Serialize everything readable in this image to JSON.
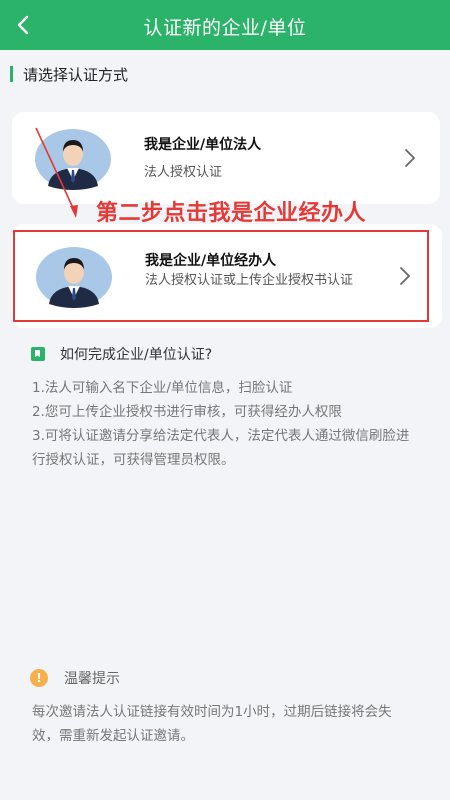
{
  "header": {
    "title": "认证新的企业/单位"
  },
  "section": {
    "title": "请选择认证方式"
  },
  "options": [
    {
      "title": "我是企业/单位法人",
      "subtitle": "法人授权认证"
    },
    {
      "title": "我是企业/单位经办人",
      "subtitle": "法人授权认证或上传企业授权书认证"
    }
  ],
  "annotation": "第二步点击我是企业经办人",
  "howto": {
    "title": "如何完成企业/单位认证?",
    "lines": [
      "1.法人可输入名下企业/单位信息，扫脸认证",
      "2.您可上传企业授权书进行审核，可获得经办人权限",
      "3.可将认证邀请分享给法定代表人，法定代表人通过微信刷脸进行授权认证，可获得管理员权限。"
    ]
  },
  "tip": {
    "icon_text": "!",
    "title": "温馨提示",
    "body": "每次邀请法人认证链接有效时间为1小时，过期后链接将会失效，需重新发起认证邀请。"
  },
  "colors": {
    "brand": "#2bb36a",
    "annotation": "#e53935",
    "warn": "#f5b04c"
  }
}
